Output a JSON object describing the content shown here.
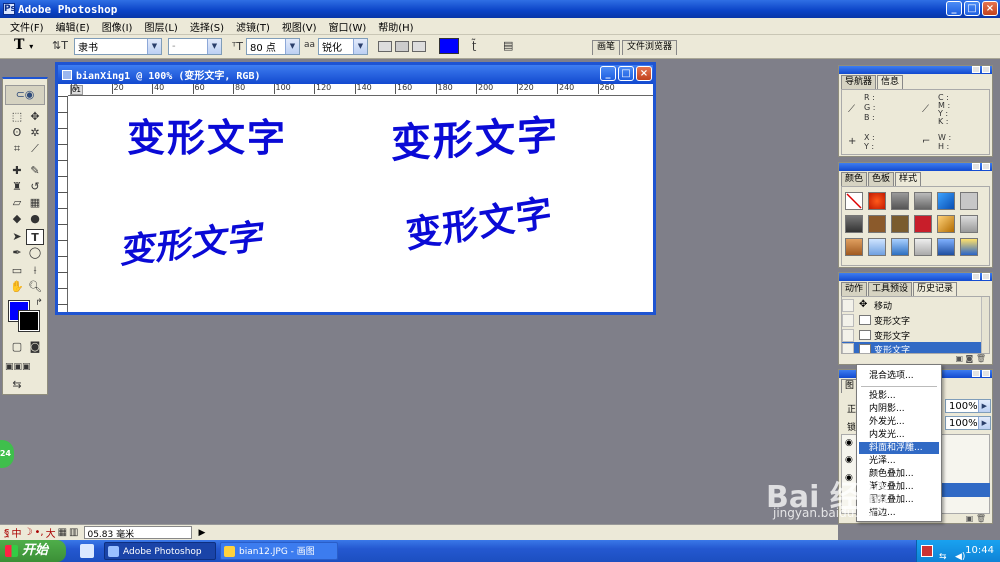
{
  "app": {
    "title": "Adobe Photoshop",
    "icon": "ps-icon"
  },
  "menubar": [
    "文件(F)",
    "编辑(E)",
    "图像(I)",
    "图层(L)",
    "选择(S)",
    "滤镜(T)",
    "视图(V)",
    "窗口(W)",
    "帮助(H)"
  ],
  "options": {
    "tool_glyph": "T",
    "font_family": "隶书",
    "font_style": "-",
    "font_size": "80 点",
    "aa_label": "aa",
    "antialias": "锐化",
    "text_color": "#0000ff",
    "palette_tabs": [
      "画笔",
      "文件浏览器"
    ]
  },
  "document": {
    "title": "bianXing1 @ 100% (变形文字, RGB)",
    "ruler_ticks": [
      "0",
      "20",
      "40",
      "60",
      "80",
      "100",
      "120",
      "140",
      "160",
      "180",
      "200",
      "220",
      "240",
      "260"
    ],
    "ruler_left_marker": "01",
    "warped_texts": [
      "变形文字",
      "变形文字",
      "变形文字",
      "变形文字"
    ]
  },
  "navigator_panel": {
    "tabs": [
      "导航器",
      "信息"
    ],
    "info_labels": [
      "R :",
      "G :",
      "B :",
      "C :",
      "M :",
      "Y :",
      "K :",
      "X :",
      "Y :",
      "W :",
      "H :"
    ]
  },
  "swatches_panel": {
    "tabs": [
      "颜色",
      "色板",
      "样式"
    ]
  },
  "history_panel": {
    "tabs": [
      "动作",
      "工具预设",
      "历史记录"
    ],
    "items": [
      "移动",
      "变形文字",
      "变形文字",
      "变形文字"
    ]
  },
  "layers_panel": {
    "tab_partial": "图",
    "blend_partial": "正",
    "lock_partial": "锁",
    "opacity": "100%",
    "fill": "100%"
  },
  "context_menu": {
    "items": [
      "混合选项...",
      "投影...",
      "内阴影...",
      "外发光...",
      "内发光...",
      "斜面和浮雕...",
      "光泽...",
      "颜色叠加...",
      "渐变叠加...",
      "图案叠加...",
      "描边..."
    ],
    "highlighted": "斜面和浮雕..."
  },
  "statusbar": {
    "ime": [
      "中",
      "大"
    ],
    "zoom_text": "05.83 毫米"
  },
  "taskbar": {
    "start": "开始",
    "tasks": [
      "Adobe Photoshop",
      "bian12.JPG - 画图"
    ],
    "clock": "10:44"
  },
  "badge": "24",
  "watermark": {
    "main": "Bai 经验",
    "sub": "jingyan.baidu.com"
  }
}
